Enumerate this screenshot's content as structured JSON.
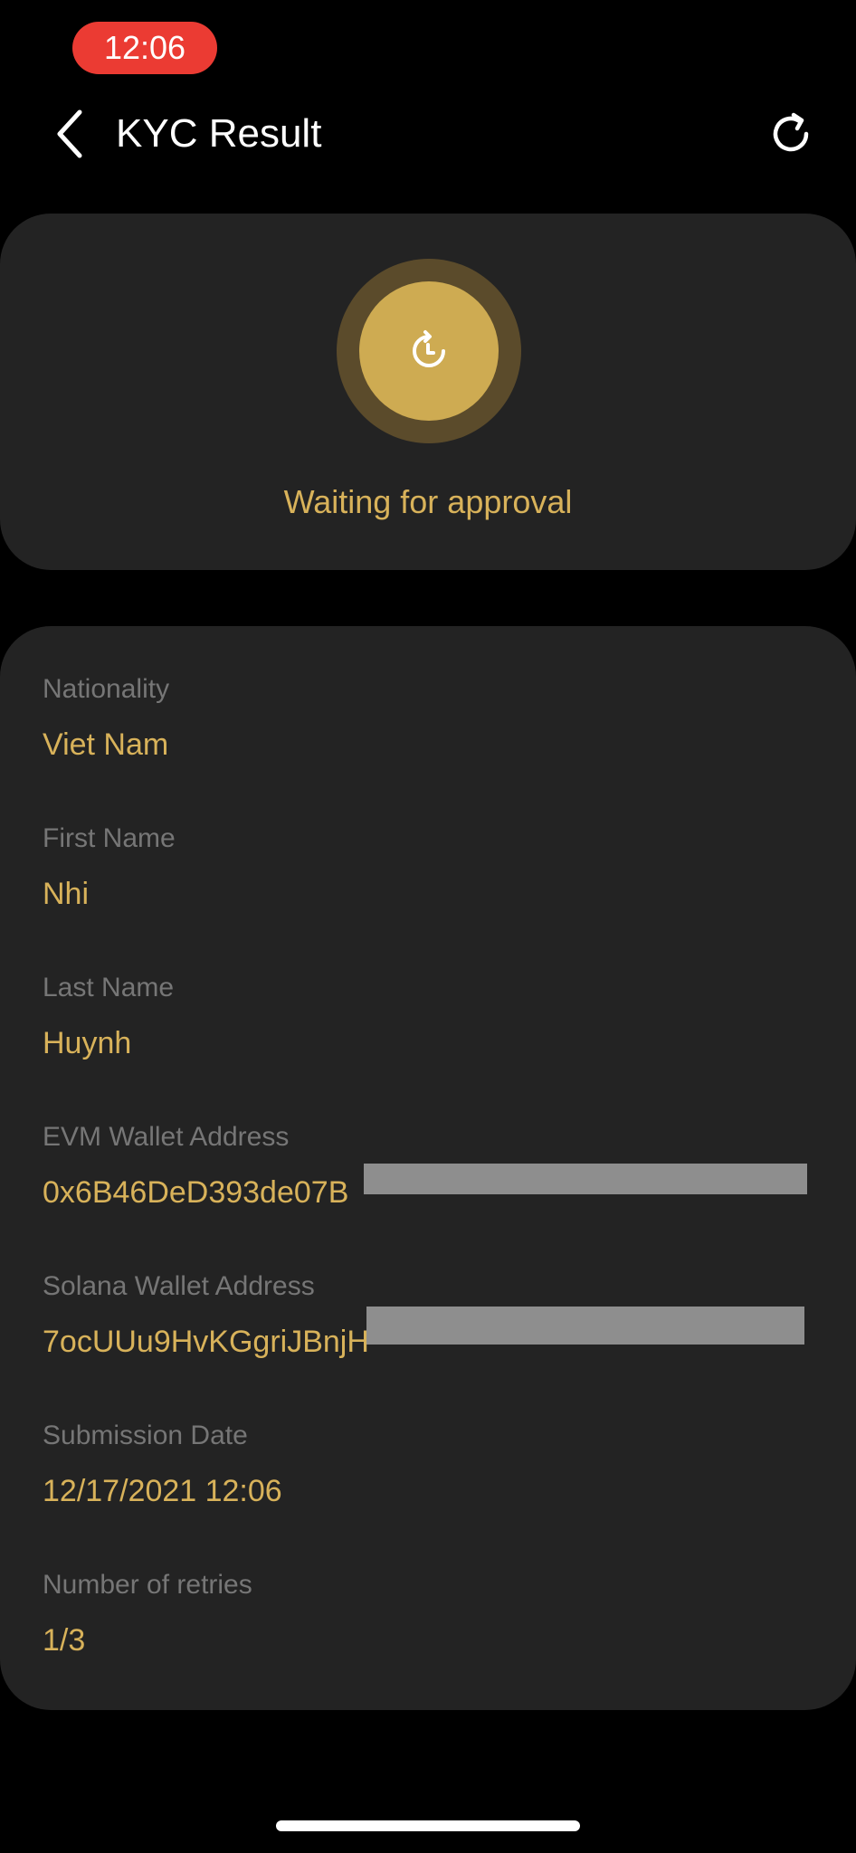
{
  "status_bar": {
    "time": "12:06"
  },
  "header": {
    "title": "KYC Result",
    "back_icon": "chevron-left-icon",
    "refresh_icon": "refresh-icon"
  },
  "status_card": {
    "status_text": "Waiting for approval",
    "status_icon": "clock-refresh-icon"
  },
  "details": {
    "fields": [
      {
        "label": "Nationality",
        "value": "Viet Nam"
      },
      {
        "label": "First Name",
        "value": "Nhi"
      },
      {
        "label": "Last Name",
        "value": "Huynh"
      },
      {
        "label": "EVM Wallet Address",
        "value": "0x6B46DeD393de07B"
      },
      {
        "label": "Solana Wallet Address",
        "value": "7ocUUu9HvKGgriJBnjH"
      },
      {
        "label": "Submission Date",
        "value": "12/17/2021 12:06"
      },
      {
        "label": "Number of retries",
        "value": "1/3"
      }
    ]
  },
  "colors": {
    "background": "#000000",
    "card": "#232323",
    "accent": "#d8b25a",
    "label": "#767676",
    "status_pill": "#eb3b33",
    "status_ring_outer": "#5b4b2b",
    "status_ring_inner": "#ceab52"
  }
}
